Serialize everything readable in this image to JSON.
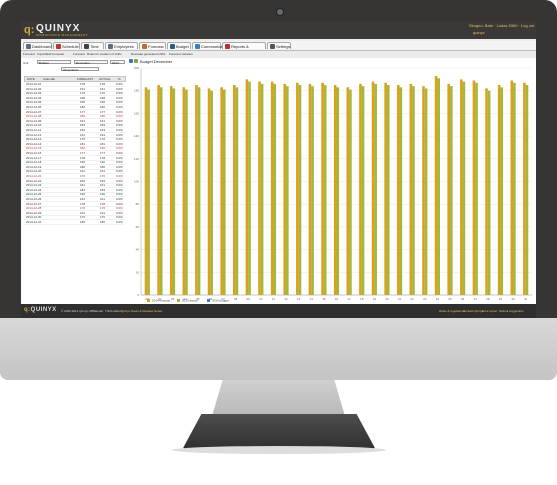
{
  "app": {
    "logo_mark": "q:",
    "logo_text": "QUINYX",
    "logo_sub": "WORKFORCE MANAGEMENT",
    "user_line1": "Skogno, Bate  ·  Lodas 5360  ·  Log out",
    "user_line2": "quinyx"
  },
  "tabs": [
    {
      "label": "Dashboard",
      "color": "#5b6b80"
    },
    {
      "label": "Schedule",
      "color": "#b8382c"
    },
    {
      "label": "Time",
      "color": "#3e3e3e"
    },
    {
      "label": "Employees",
      "color": "#5e6d7a"
    },
    {
      "label": "Forecast",
      "color": "#c26a2a"
    },
    {
      "label": "Budget",
      "color": "#2f5a8c"
    },
    {
      "label": "Communicate",
      "color": "#3c7fb8"
    },
    {
      "label": "Reports & Statistics",
      "color": "#b03232"
    },
    {
      "label": "Settings",
      "color": "#555555"
    }
  ],
  "subtabs": [
    "Forecast",
    "Import/Edit Forecast",
    "Forecast",
    "Rules for creation of shifts",
    "Recreate generated shifts",
    "Forecast variation"
  ],
  "controls": {
    "unit_label": "Unit",
    "unit_value": "Butiken",
    "month_value": "December",
    "year_value": "2014",
    "section_value": "All sections"
  },
  "grid": {
    "headers": [
      "DATE",
      "Calendar",
      "FORECAST",
      "ACTUAL",
      "%"
    ],
    "rows": [
      {
        "date": "2014-12-01",
        "forecast": "178",
        "actual": "178",
        "pct": "0.0%",
        "red": false
      },
      {
        "date": "2014-12-02",
        "forecast": "161",
        "actual": "161",
        "pct": "0.0%",
        "red": false
      },
      {
        "date": "2014-12-03",
        "forecast": "170",
        "actual": "170",
        "pct": "0.0%",
        "red": false
      },
      {
        "date": "2014-12-04",
        "forecast": "168",
        "actual": "168",
        "pct": "0.0%",
        "red": false
      },
      {
        "date": "2014-12-05",
        "forecast": "190",
        "actual": "190",
        "pct": "0.0%",
        "red": false
      },
      {
        "date": "2014-12-06",
        "forecast": "182",
        "actual": "182",
        "pct": "0.0%",
        "red": false
      },
      {
        "date": "2014-12-07",
        "forecast": "177",
        "actual": "177",
        "pct": "0.0%",
        "red": false
      },
      {
        "date": "2014-12-08",
        "forecast": "186",
        "actual": "186",
        "pct": "0.0%",
        "red": true
      },
      {
        "date": "2014-12-09",
        "forecast": "161",
        "actual": "161",
        "pct": "0.0%",
        "red": false
      },
      {
        "date": "2014-12-10",
        "forecast": "183",
        "actual": "183",
        "pct": "0.0%",
        "red": false
      },
      {
        "date": "2014-12-11",
        "forecast": "163",
        "actual": "163",
        "pct": "0.0%",
        "red": false
      },
      {
        "date": "2014-12-12",
        "forecast": "191",
        "actual": "191",
        "pct": "0.0%",
        "red": false
      },
      {
        "date": "2014-12-13",
        "forecast": "176",
        "actual": "176",
        "pct": "0.0%",
        "red": false
      },
      {
        "date": "2014-12-14",
        "forecast": "181",
        "actual": "181",
        "pct": "0.0%",
        "red": false
      },
      {
        "date": "2014-12-15",
        "forecast": "182",
        "actual": "182",
        "pct": "0.0%",
        "red": true
      },
      {
        "date": "2014-12-16",
        "forecast": "177",
        "actual": "177",
        "pct": "0.0%",
        "red": false
      },
      {
        "date": "2014-12-17",
        "forecast": "178",
        "actual": "178",
        "pct": "0.0%",
        "red": false
      },
      {
        "date": "2014-12-18",
        "forecast": "190",
        "actual": "190",
        "pct": "0.0%",
        "red": false
      },
      {
        "date": "2014-12-19",
        "forecast": "180",
        "actual": "180",
        "pct": "0.0%",
        "red": false
      },
      {
        "date": "2014-12-20",
        "forecast": "161",
        "actual": "161",
        "pct": "0.0%",
        "red": false
      },
      {
        "date": "2014-12-21",
        "forecast": "176",
        "actual": "176",
        "pct": "0.0%",
        "red": true
      },
      {
        "date": "2014-12-22",
        "forecast": "183",
        "actual": "183",
        "pct": "0.0%",
        "red": false
      },
      {
        "date": "2014-12-23",
        "forecast": "161",
        "actual": "161",
        "pct": "0.0%",
        "red": false
      },
      {
        "date": "2014-12-24",
        "forecast": "183",
        "actual": "183",
        "pct": "0.0%",
        "red": false
      },
      {
        "date": "2014-12-25",
        "forecast": "190",
        "actual": "190",
        "pct": "0.0%",
        "red": false
      },
      {
        "date": "2014-12-26",
        "forecast": "161",
        "actual": "161",
        "pct": "0.0%",
        "red": false
      },
      {
        "date": "2014-12-27",
        "forecast": "178",
        "actual": "178",
        "pct": "0.0%",
        "red": false
      },
      {
        "date": "2014-12-28",
        "forecast": "176",
        "actual": "176",
        "pct": "0.0%",
        "red": true
      },
      {
        "date": "2014-12-29",
        "forecast": "161",
        "actual": "161",
        "pct": "0.0%",
        "red": false
      },
      {
        "date": "2014-12-30",
        "forecast": "170",
        "actual": "170",
        "pct": "0.0%",
        "red": false
      },
      {
        "date": "2014-12-31",
        "forecast": "180",
        "actual": "180",
        "pct": "0.0%",
        "red": false
      }
    ]
  },
  "chart_title": "Budget December",
  "chart_data": {
    "type": "bar",
    "title": "Budget December",
    "categories": [
      "01",
      "02",
      "03",
      "04",
      "05",
      "06",
      "07",
      "08",
      "09",
      "10",
      "11",
      "12",
      "13",
      "14",
      "15",
      "16",
      "17",
      "18",
      "19",
      "20",
      "21",
      "22",
      "23",
      "24",
      "25",
      "26",
      "27",
      "28",
      "29",
      "30",
      "31"
    ],
    "series": [
      {
        "name": "2014 forecast",
        "color": "#d9a21e",
        "values": [
          183,
          185,
          184,
          183,
          185,
          182,
          183,
          185,
          190,
          188,
          188,
          186,
          187,
          186,
          187,
          185,
          183,
          186,
          188,
          187,
          185,
          186,
          184,
          193,
          186,
          190,
          189,
          182,
          185,
          189,
          187
        ]
      },
      {
        "name": "2013 actual",
        "color": "#a5b63a",
        "values": [
          181,
          183,
          182,
          181,
          183,
          180,
          181,
          183,
          188,
          186,
          186,
          184,
          185,
          184,
          185,
          183,
          181,
          184,
          186,
          185,
          183,
          184,
          182,
          191,
          184,
          188,
          187,
          180,
          183,
          187,
          185
        ]
      },
      {
        "name": "2014 budget",
        "color": "#3e7cc6",
        "values": [
          0,
          0,
          0,
          0,
          0,
          0,
          0,
          0,
          0,
          0,
          0,
          0,
          0,
          0,
          0,
          0,
          0,
          0,
          0,
          0,
          0,
          0,
          0,
          0,
          0,
          0,
          0,
          0,
          0,
          0,
          0
        ]
      }
    ],
    "ylim": [
      0,
      200
    ],
    "yticks": [
      0,
      20,
      40,
      60,
      80,
      100,
      120,
      140,
      160,
      180,
      200
    ],
    "legend_position": "bottom-left",
    "grid": true
  },
  "footer": {
    "logo_mark": "q:",
    "logo_text": "QUINYX",
    "copyright": "© 2000-2014 Quinyx AB",
    "links_left": [
      "Manual",
      "Third edition",
      "Quinyx News & Release Notes"
    ],
    "links_right": [
      "Rules & regulations",
      "Contact Quinyx",
      "Error report",
      "Submit suggestion"
    ]
  }
}
